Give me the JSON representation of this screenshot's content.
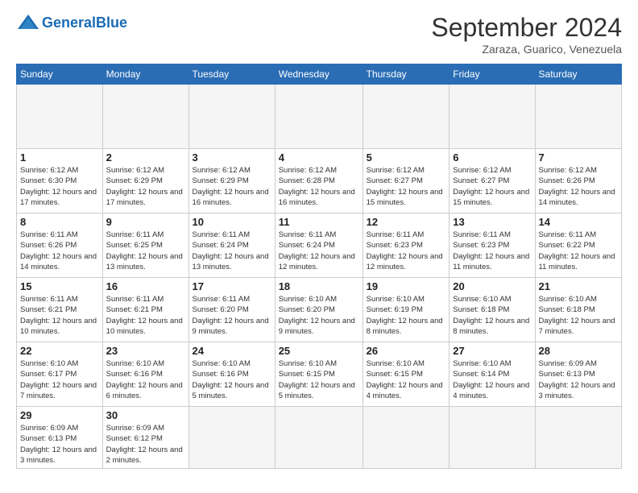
{
  "header": {
    "logo": {
      "part1": "General",
      "part2": "Blue"
    },
    "title": "September 2024",
    "location": "Zaraza, Guarico, Venezuela"
  },
  "calendar": {
    "days_of_week": [
      "Sunday",
      "Monday",
      "Tuesday",
      "Wednesday",
      "Thursday",
      "Friday",
      "Saturday"
    ],
    "weeks": [
      [
        {
          "day": "",
          "empty": true
        },
        {
          "day": "",
          "empty": true
        },
        {
          "day": "",
          "empty": true
        },
        {
          "day": "",
          "empty": true
        },
        {
          "day": "",
          "empty": true
        },
        {
          "day": "",
          "empty": true
        },
        {
          "day": "",
          "empty": true
        }
      ],
      [
        {
          "day": "1",
          "sunrise": "6:12 AM",
          "sunset": "6:30 PM",
          "daylight": "12 hours and 17 minutes."
        },
        {
          "day": "2",
          "sunrise": "6:12 AM",
          "sunset": "6:29 PM",
          "daylight": "12 hours and 17 minutes."
        },
        {
          "day": "3",
          "sunrise": "6:12 AM",
          "sunset": "6:29 PM",
          "daylight": "12 hours and 16 minutes."
        },
        {
          "day": "4",
          "sunrise": "6:12 AM",
          "sunset": "6:28 PM",
          "daylight": "12 hours and 16 minutes."
        },
        {
          "day": "5",
          "sunrise": "6:12 AM",
          "sunset": "6:27 PM",
          "daylight": "12 hours and 15 minutes."
        },
        {
          "day": "6",
          "sunrise": "6:12 AM",
          "sunset": "6:27 PM",
          "daylight": "12 hours and 15 minutes."
        },
        {
          "day": "7",
          "sunrise": "6:12 AM",
          "sunset": "6:26 PM",
          "daylight": "12 hours and 14 minutes."
        }
      ],
      [
        {
          "day": "8",
          "sunrise": "6:11 AM",
          "sunset": "6:26 PM",
          "daylight": "12 hours and 14 minutes."
        },
        {
          "day": "9",
          "sunrise": "6:11 AM",
          "sunset": "6:25 PM",
          "daylight": "12 hours and 13 minutes."
        },
        {
          "day": "10",
          "sunrise": "6:11 AM",
          "sunset": "6:24 PM",
          "daylight": "12 hours and 13 minutes."
        },
        {
          "day": "11",
          "sunrise": "6:11 AM",
          "sunset": "6:24 PM",
          "daylight": "12 hours and 12 minutes."
        },
        {
          "day": "12",
          "sunrise": "6:11 AM",
          "sunset": "6:23 PM",
          "daylight": "12 hours and 12 minutes."
        },
        {
          "day": "13",
          "sunrise": "6:11 AM",
          "sunset": "6:23 PM",
          "daylight": "12 hours and 11 minutes."
        },
        {
          "day": "14",
          "sunrise": "6:11 AM",
          "sunset": "6:22 PM",
          "daylight": "12 hours and 11 minutes."
        }
      ],
      [
        {
          "day": "15",
          "sunrise": "6:11 AM",
          "sunset": "6:21 PM",
          "daylight": "12 hours and 10 minutes."
        },
        {
          "day": "16",
          "sunrise": "6:11 AM",
          "sunset": "6:21 PM",
          "daylight": "12 hours and 10 minutes."
        },
        {
          "day": "17",
          "sunrise": "6:11 AM",
          "sunset": "6:20 PM",
          "daylight": "12 hours and 9 minutes."
        },
        {
          "day": "18",
          "sunrise": "6:10 AM",
          "sunset": "6:20 PM",
          "daylight": "12 hours and 9 minutes."
        },
        {
          "day": "19",
          "sunrise": "6:10 AM",
          "sunset": "6:19 PM",
          "daylight": "12 hours and 8 minutes."
        },
        {
          "day": "20",
          "sunrise": "6:10 AM",
          "sunset": "6:18 PM",
          "daylight": "12 hours and 8 minutes."
        },
        {
          "day": "21",
          "sunrise": "6:10 AM",
          "sunset": "6:18 PM",
          "daylight": "12 hours and 7 minutes."
        }
      ],
      [
        {
          "day": "22",
          "sunrise": "6:10 AM",
          "sunset": "6:17 PM",
          "daylight": "12 hours and 7 minutes."
        },
        {
          "day": "23",
          "sunrise": "6:10 AM",
          "sunset": "6:16 PM",
          "daylight": "12 hours and 6 minutes."
        },
        {
          "day": "24",
          "sunrise": "6:10 AM",
          "sunset": "6:16 PM",
          "daylight": "12 hours and 5 minutes."
        },
        {
          "day": "25",
          "sunrise": "6:10 AM",
          "sunset": "6:15 PM",
          "daylight": "12 hours and 5 minutes."
        },
        {
          "day": "26",
          "sunrise": "6:10 AM",
          "sunset": "6:15 PM",
          "daylight": "12 hours and 4 minutes."
        },
        {
          "day": "27",
          "sunrise": "6:10 AM",
          "sunset": "6:14 PM",
          "daylight": "12 hours and 4 minutes."
        },
        {
          "day": "28",
          "sunrise": "6:09 AM",
          "sunset": "6:13 PM",
          "daylight": "12 hours and 3 minutes."
        }
      ],
      [
        {
          "day": "29",
          "sunrise": "6:09 AM",
          "sunset": "6:13 PM",
          "daylight": "12 hours and 3 minutes."
        },
        {
          "day": "30",
          "sunrise": "6:09 AM",
          "sunset": "6:12 PM",
          "daylight": "12 hours and 2 minutes."
        },
        {
          "day": "",
          "empty": true
        },
        {
          "day": "",
          "empty": true
        },
        {
          "day": "",
          "empty": true
        },
        {
          "day": "",
          "empty": true
        },
        {
          "day": "",
          "empty": true
        }
      ]
    ]
  }
}
